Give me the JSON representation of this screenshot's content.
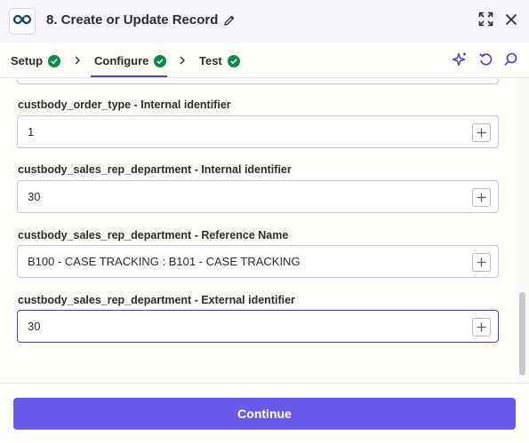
{
  "header": {
    "title": "8. Create or Update Record",
    "app_icon": "infinity-logo-icon",
    "icons": [
      "pencil-icon",
      "expand-icon",
      "close-icon"
    ]
  },
  "tabs": [
    {
      "label": "Setup",
      "status": "complete"
    },
    {
      "label": "Configure",
      "status": "complete",
      "active": true
    },
    {
      "label": "Test",
      "status": "complete"
    }
  ],
  "toolbar_icons": [
    "sparkle-icon",
    "undo-icon",
    "search-icon"
  ],
  "fields": [
    {
      "label": "custbody_order_type - Internal identifier",
      "value": "1"
    },
    {
      "label": "custbody_sales_rep_department - Internal identifier",
      "value": "30"
    },
    {
      "label": "custbody_sales_rep_department - Reference Name",
      "value": "B100 - CASE TRACKING : B101 - CASE TRACKING"
    },
    {
      "label": "custbody_sales_rep_department - External identifier",
      "value": "30",
      "focused": true
    }
  ],
  "footer": {
    "continue_label": "Continue"
  },
  "colors": {
    "accent": "#503ebd",
    "button": "#695be8",
    "check": "#0f884e",
    "header_bg": "#f7f6fd"
  }
}
